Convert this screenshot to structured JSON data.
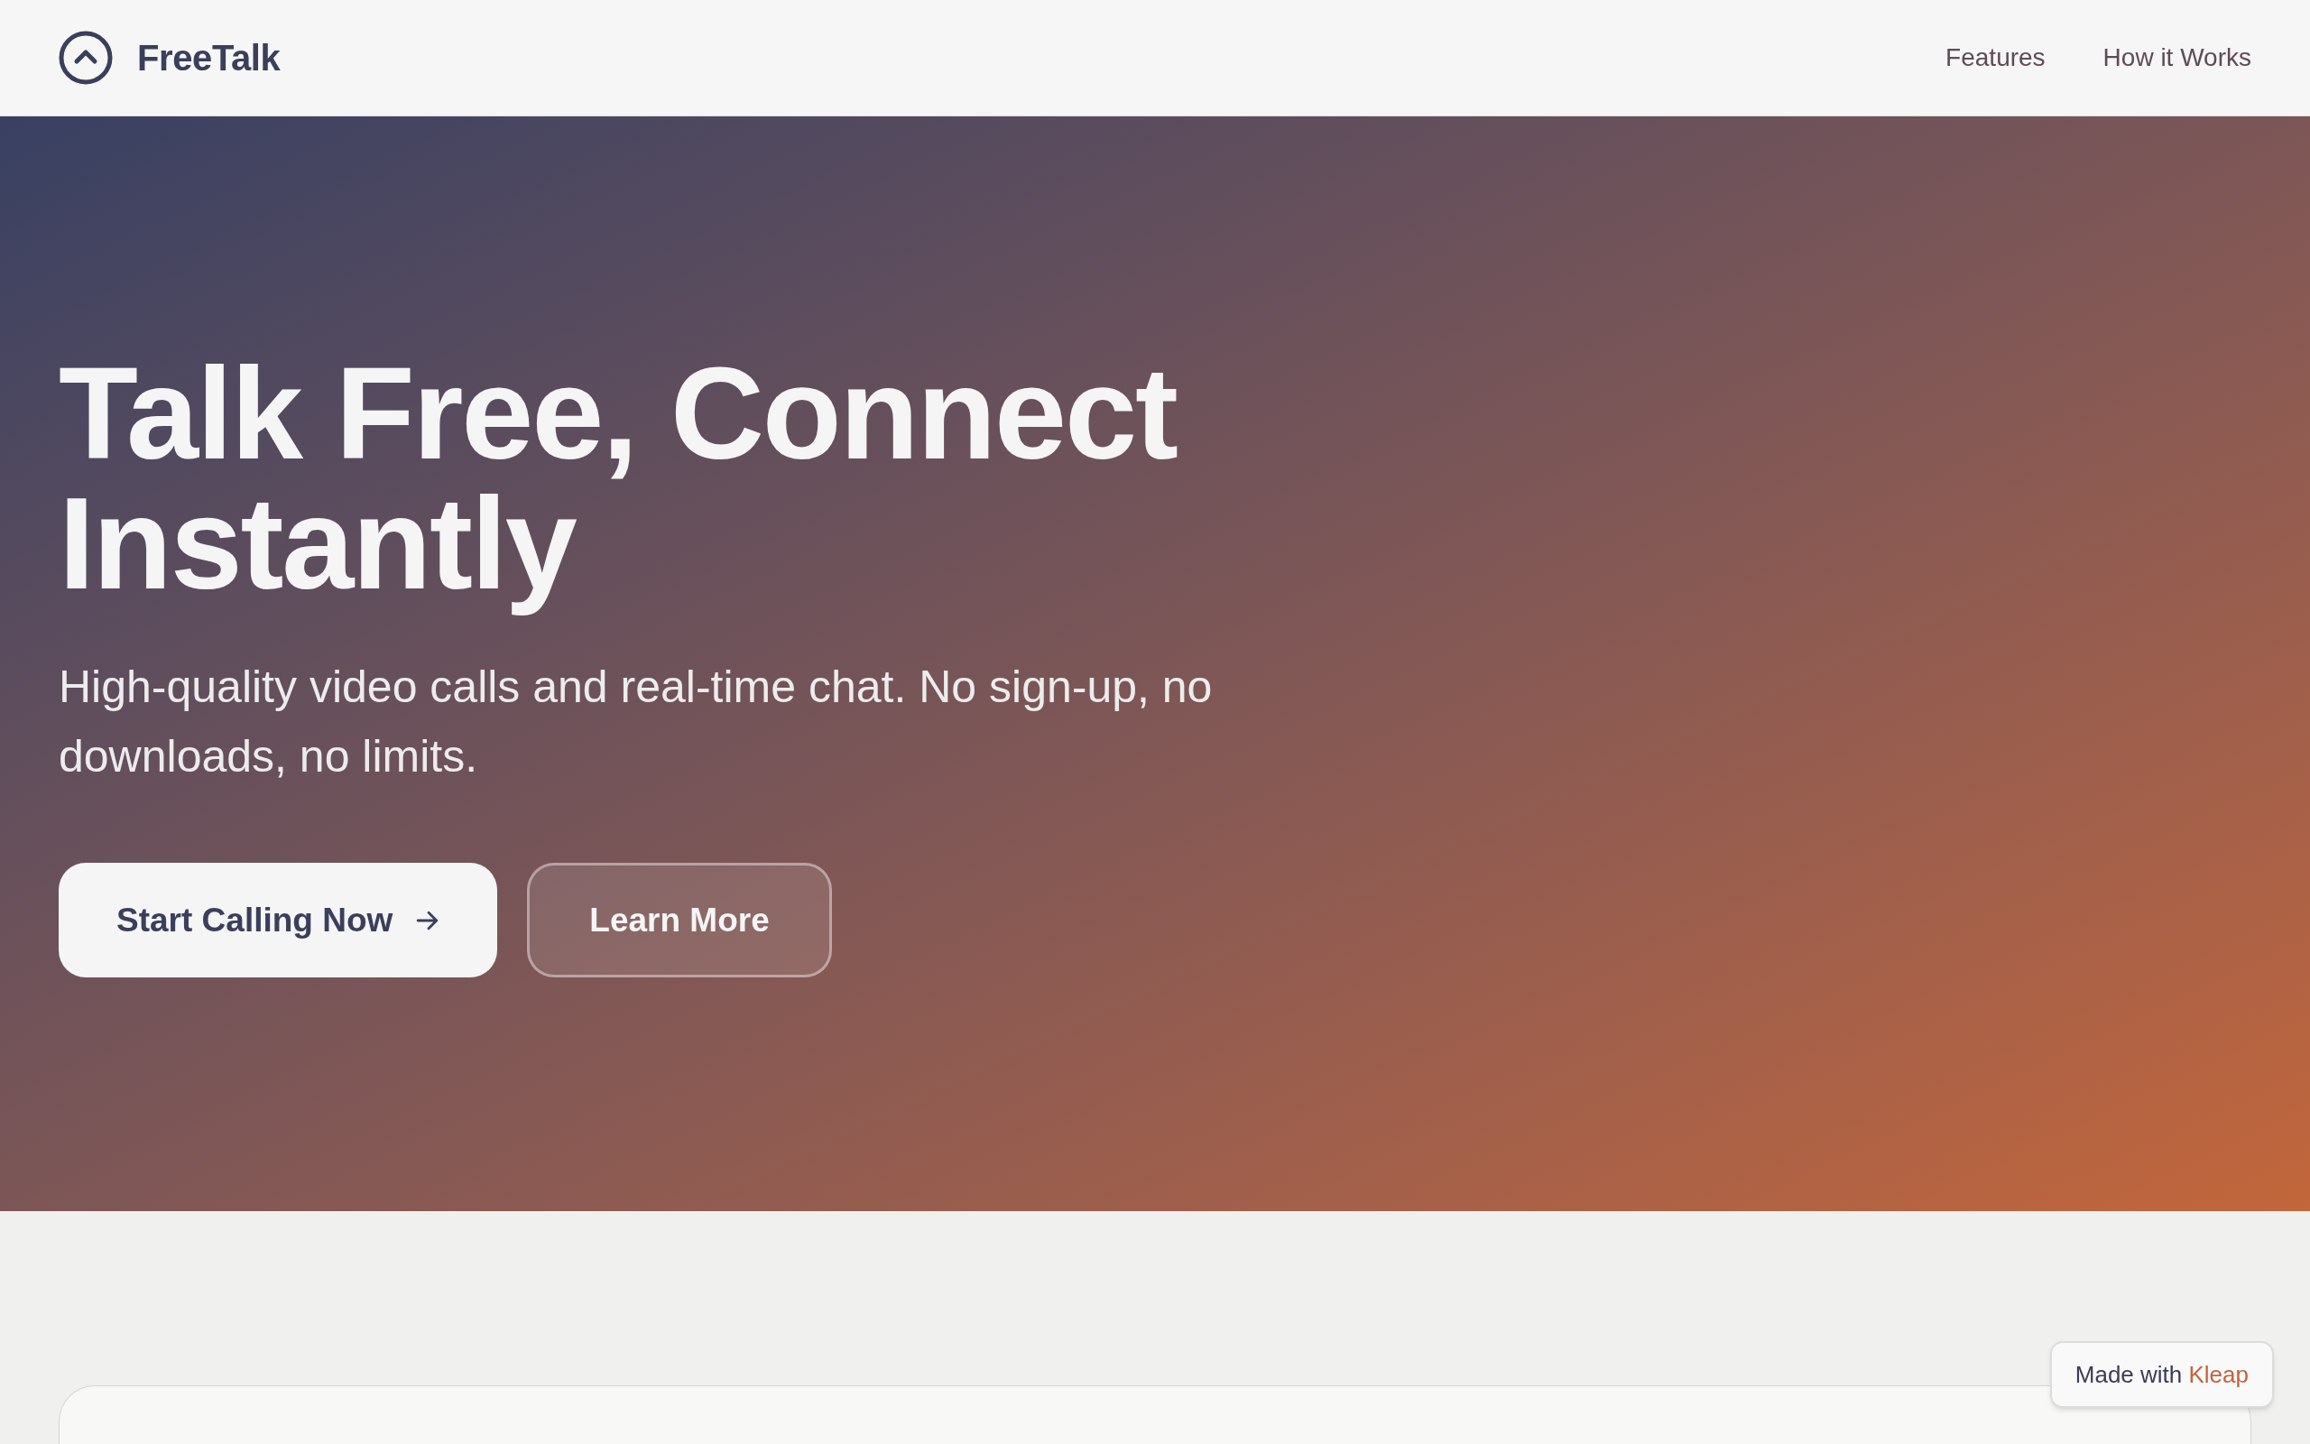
{
  "header": {
    "logo": {
      "name": "FreeTalk"
    },
    "nav": [
      "Features",
      "How it Works"
    ]
  },
  "hero": {
    "title": "Talk Free, Connect Instantly",
    "subtitle": "High-quality video calls and real-time chat. No sign-up, no downloads, no limits.",
    "buttons": [
      {
        "label": "Start Calling Now",
        "kind": "primary"
      },
      {
        "label": "Learn More",
        "kind": "secondary"
      }
    ]
  },
  "badge": {
    "text": "Made with",
    "brand": "Kleap"
  }
}
